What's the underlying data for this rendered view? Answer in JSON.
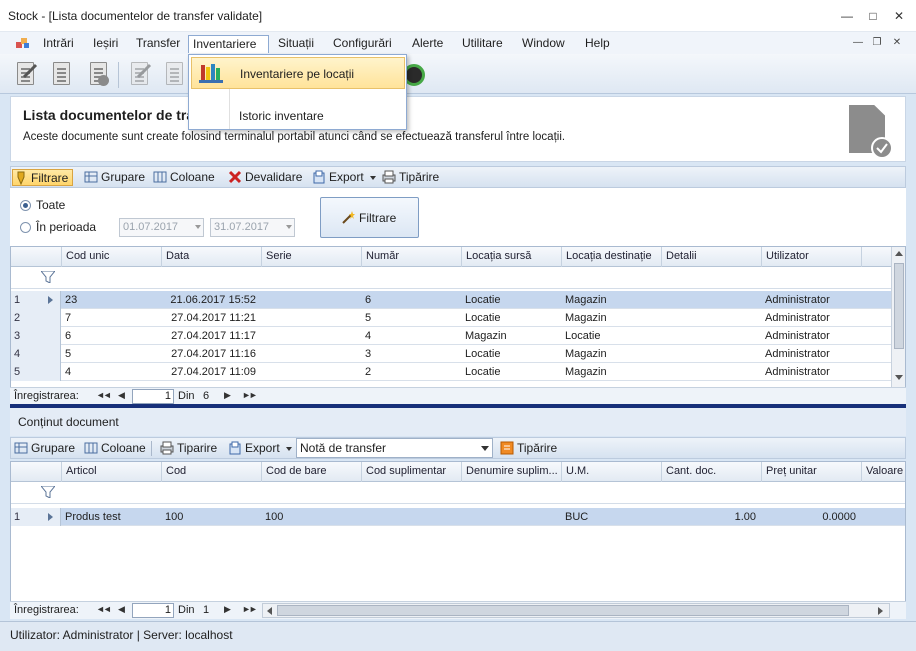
{
  "window": {
    "title": "Stock - [Lista documentelor de transfer validate]"
  },
  "menu": {
    "items": [
      "Intrări",
      "Ieșiri",
      "Transfer",
      "Inventariere",
      "Situații",
      "Configurări",
      "Alerte",
      "Utilitare",
      "Window",
      "Help"
    ],
    "active_index": 3
  },
  "dropdown": {
    "items": [
      "Inventariere pe locații",
      "Istoric inventare"
    ],
    "highlighted_index": 0
  },
  "header": {
    "title": "Lista documentelor de transfer validate",
    "description": "Aceste documente sunt create folosind terminalul portabil atunci când se efectuează transferul între locații."
  },
  "toolbar1": {
    "filter": "Filtrare",
    "group": "Grupare",
    "columns": "Coloane",
    "unvalidate": "Devalidare",
    "export": "Export",
    "print": "Tipărire"
  },
  "filter": {
    "all_label": "Toate",
    "period_label": "În perioada",
    "date_from": "01.07.2017",
    "date_to": "31.07.2017",
    "button": "Filtrare",
    "selected": "all"
  },
  "grid1": {
    "columns": [
      "Cod unic",
      "Data",
      "Serie",
      "Număr",
      "Locația sursă",
      "Locația destinație",
      "Detalii",
      "Utilizator"
    ],
    "rows": [
      {
        "n": "1",
        "cod": "23",
        "data": "21.06.2017 15:52",
        "serie": "",
        "numar": "6",
        "sursa": "Locatie",
        "dest": "Magazin",
        "detalii": "",
        "user": "Administrator"
      },
      {
        "n": "2",
        "cod": "7",
        "data": "27.04.2017 11:21",
        "serie": "",
        "numar": "5",
        "sursa": "Locatie",
        "dest": "Magazin",
        "detalii": "",
        "user": "Administrator"
      },
      {
        "n": "3",
        "cod": "6",
        "data": "27.04.2017 11:17",
        "serie": "",
        "numar": "4",
        "sursa": "Magazin",
        "dest": "Locatie",
        "detalii": "",
        "user": "Administrator"
      },
      {
        "n": "4",
        "cod": "5",
        "data": "27.04.2017 11:16",
        "serie": "",
        "numar": "3",
        "sursa": "Locatie",
        "dest": "Magazin",
        "detalii": "",
        "user": "Administrator"
      },
      {
        "n": "5",
        "cod": "4",
        "data": "27.04.2017 11:09",
        "serie": "",
        "numar": "2",
        "sursa": "Locatie",
        "dest": "Magazin",
        "detalii": "",
        "user": "Administrator"
      }
    ],
    "nav": {
      "label": "Înregistrarea:",
      "page": "1",
      "of": "Din",
      "total": "6"
    }
  },
  "content": {
    "label": "Conținut document"
  },
  "toolbar2": {
    "group": "Grupare",
    "columns": "Coloane",
    "print": "Tiparire",
    "export": "Export",
    "report_select": "Notă de transfer",
    "print2": "Tipărire"
  },
  "grid2": {
    "columns": [
      "Articol",
      "Cod",
      "Cod de bare",
      "Cod suplimentar",
      "Denumire suplim...",
      "U.M.",
      "Cant. doc.",
      "Preț unitar",
      "Valoare"
    ],
    "rows": [
      {
        "n": "1",
        "articol": "Produs test",
        "cod": "100",
        "bare": "100",
        "supl": "",
        "den": "",
        "um": "BUC",
        "cant": "1.00",
        "pret": "0.0000",
        "val": ""
      }
    ],
    "nav": {
      "label": "Înregistrarea:",
      "page": "1",
      "of": "Din",
      "total": "1"
    }
  },
  "status": {
    "text": "Utilizator: Administrator | Server: localhost"
  },
  "colors": {
    "accent": "#17307a",
    "selection": "#c6d7ee",
    "highlight": "#ffe39a"
  }
}
